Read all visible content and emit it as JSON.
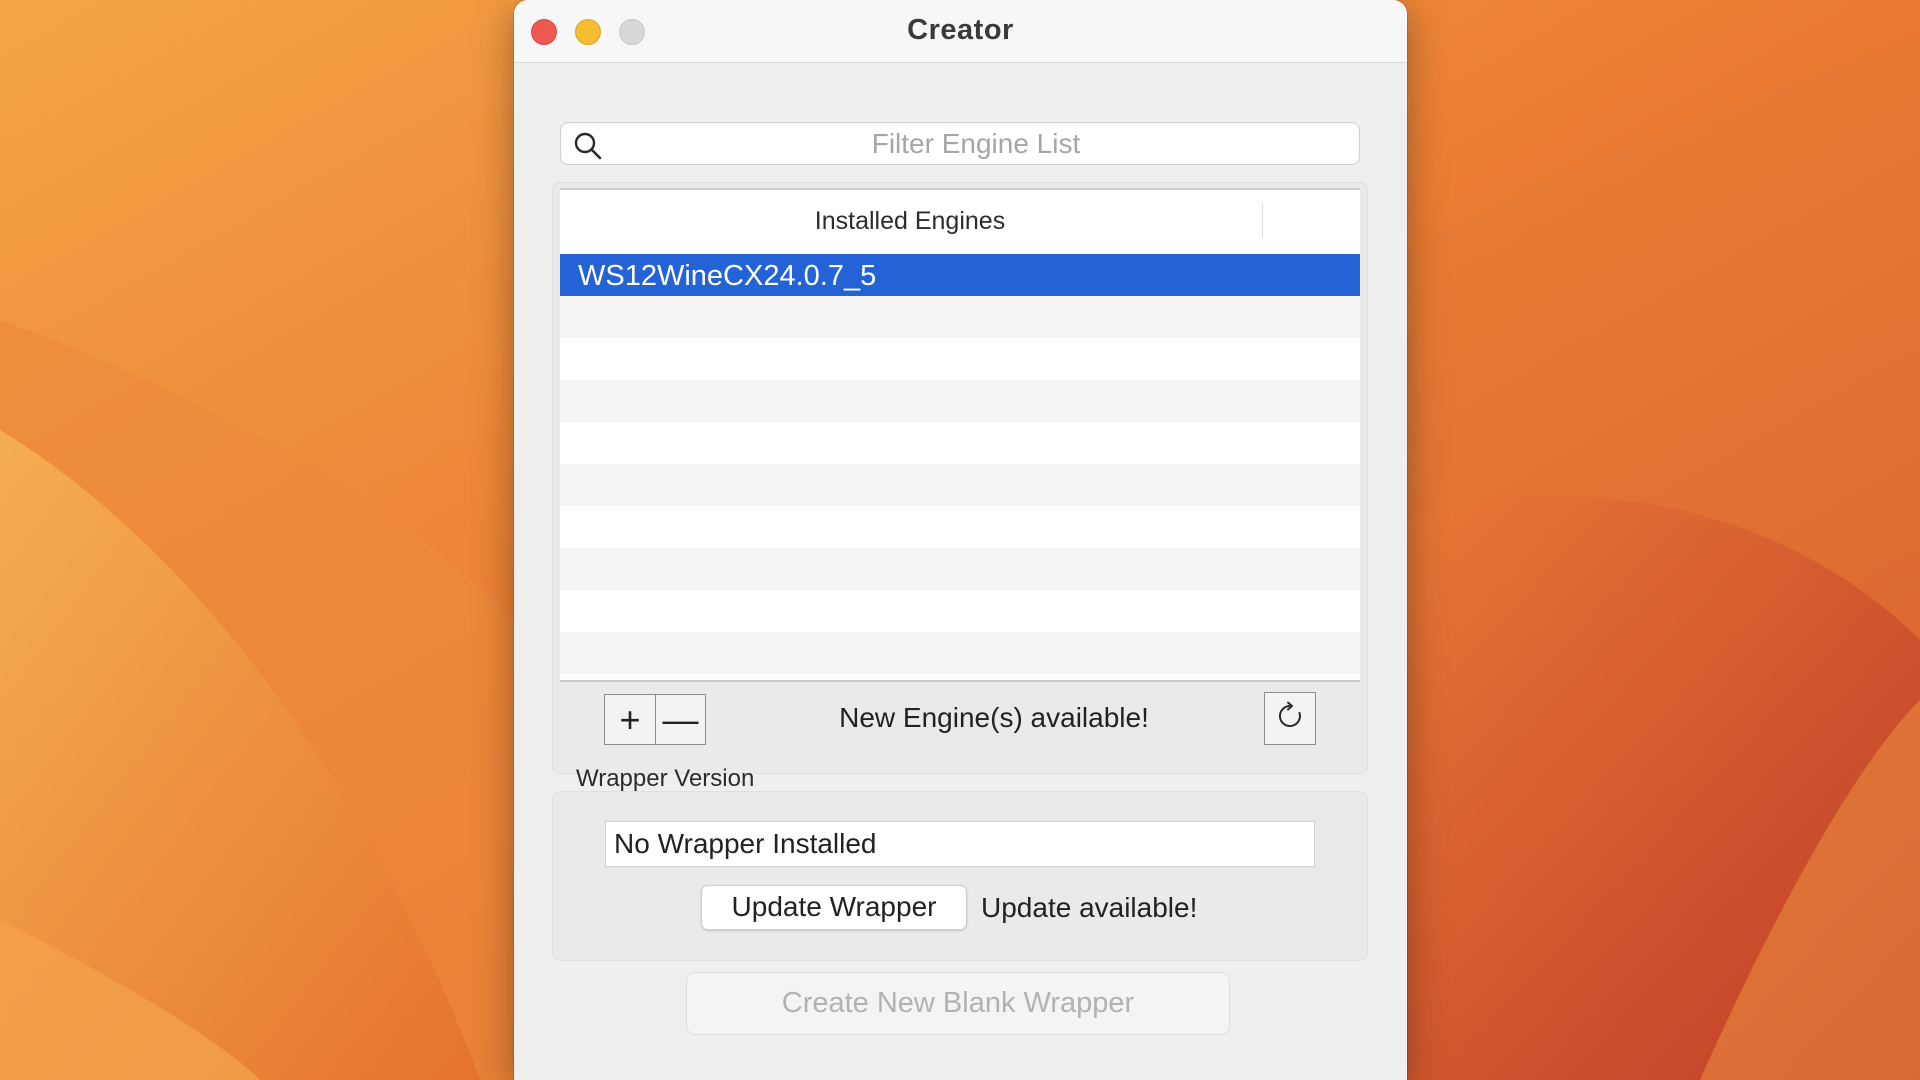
{
  "window": {
    "title": "Creator"
  },
  "search": {
    "placeholder": "Filter Engine List",
    "value": ""
  },
  "engines_table": {
    "column_header": "Installed Engines",
    "rows": [
      {
        "label": "WS12WineCX24.0.7_5",
        "selected": true
      }
    ]
  },
  "engine_toolbar": {
    "add_symbol": "+",
    "remove_symbol": "—",
    "status": "New Engine(s) available!",
    "refresh_icon": "refresh-icon"
  },
  "wrapper": {
    "section_label": "Wrapper Version",
    "version_value": "No Wrapper Installed",
    "update_button": "Update Wrapper",
    "update_status": "Update available!"
  },
  "footer": {
    "create_button": "Create New Blank Wrapper"
  },
  "colors": {
    "selection": "#2463d6",
    "close": "#ee5a52",
    "minimize": "#f5bd2f",
    "zoom_disabled": "#d8d8d8"
  }
}
